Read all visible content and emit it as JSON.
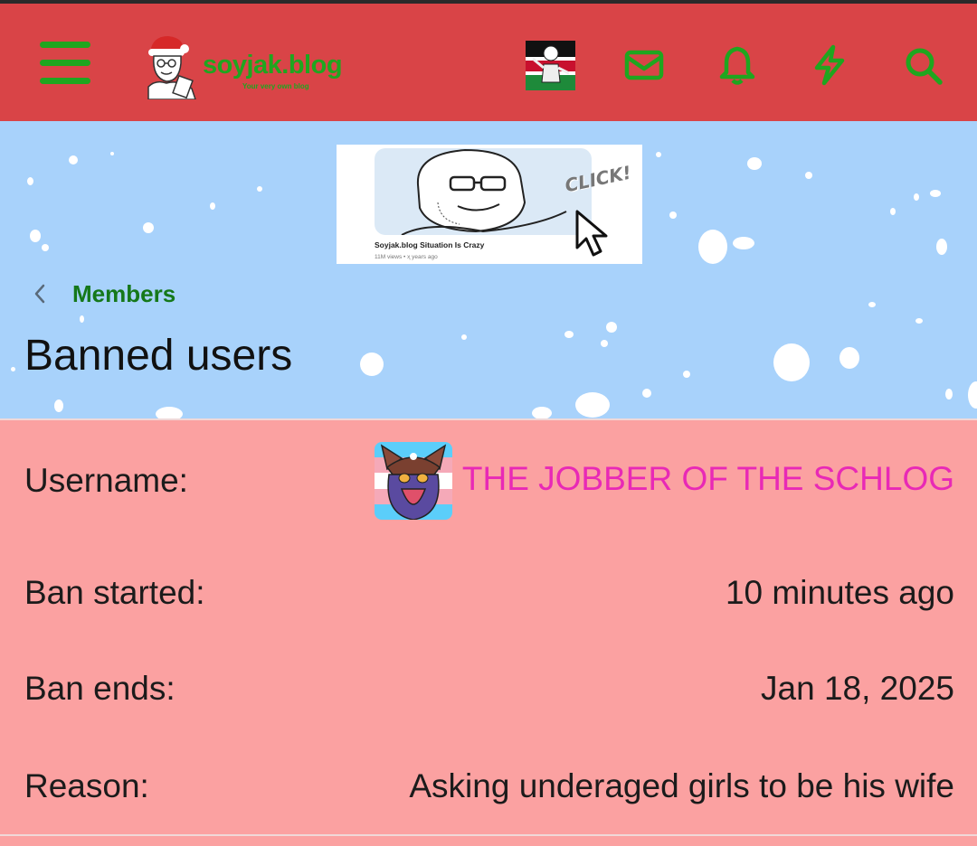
{
  "header": {
    "logo_text": "soyjak.blog",
    "logo_tagline": "Your very own blog",
    "icons": [
      "menu-icon",
      "inbox-icon",
      "bell-icon",
      "lightning-icon",
      "search-icon"
    ],
    "accent_color": "#1fa61f",
    "header_color": "#d94447"
  },
  "banner": {
    "click_text": "CLICK!",
    "title": "Soyjak.blog Situation Is Crazy",
    "meta": "11M views • ҳ years ago"
  },
  "breadcrumb": {
    "label": "Members"
  },
  "page": {
    "title": "Banned users"
  },
  "ban": {
    "username_label": "Username:",
    "username": "THE JOBBER OF THE SCHLOG",
    "username_color": "#e829b6",
    "started_label": "Ban started:",
    "started_value": "10 minutes ago",
    "ends_label": "Ban ends:",
    "ends_value": "Jan 18, 2025",
    "reason_label": "Reason:",
    "reason_value": "Asking underaged girls to be his wife"
  }
}
